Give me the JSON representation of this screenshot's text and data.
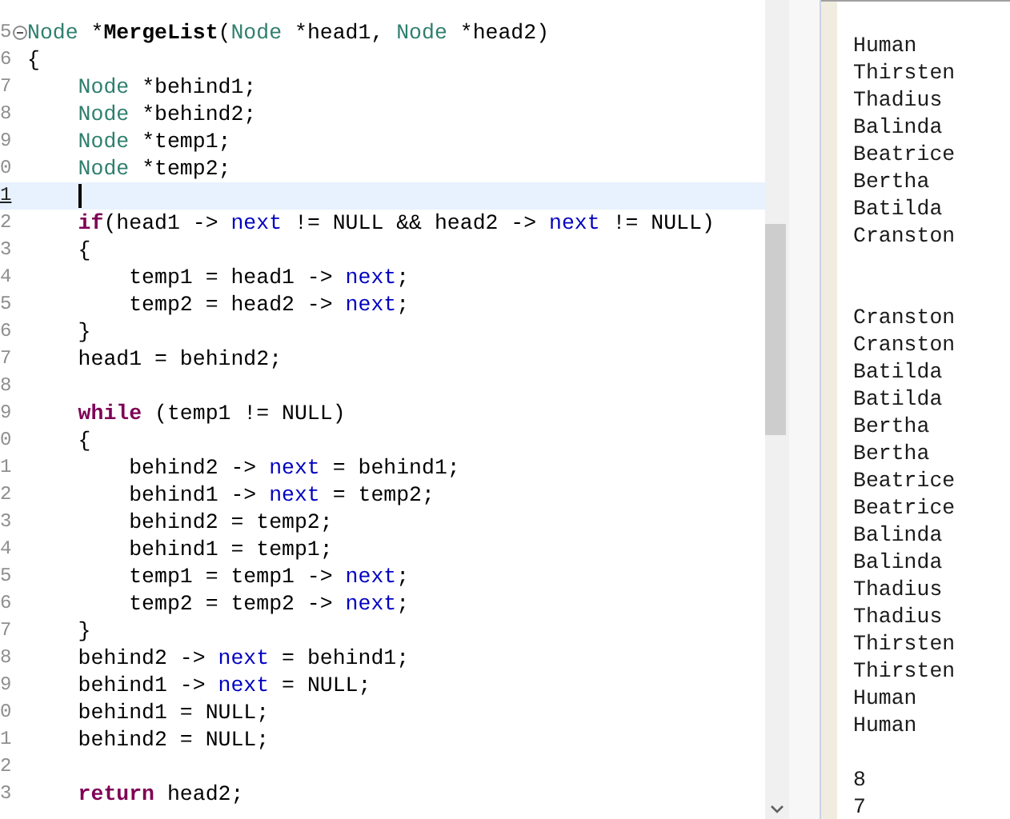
{
  "editor": {
    "lines": [
      {
        "number": "5",
        "fold": true,
        "current": false,
        "tokens": [
          {
            "kind": "type",
            "text": "Node"
          },
          {
            "kind": "plain",
            "text": " *"
          },
          {
            "kind": "func",
            "text": "MergeList"
          },
          {
            "kind": "plain",
            "text": "("
          },
          {
            "kind": "type",
            "text": "Node"
          },
          {
            "kind": "plain",
            "text": " *head1, "
          },
          {
            "kind": "type",
            "text": "Node"
          },
          {
            "kind": "plain",
            "text": " *head2)"
          }
        ]
      },
      {
        "number": "6",
        "fold": false,
        "current": false,
        "tokens": [
          {
            "kind": "plain",
            "text": "{"
          }
        ]
      },
      {
        "number": "7",
        "fold": false,
        "current": false,
        "tokens": [
          {
            "kind": "type",
            "text": "    Node"
          },
          {
            "kind": "plain",
            "text": " *behind1;"
          }
        ]
      },
      {
        "number": "8",
        "fold": false,
        "current": false,
        "tokens": [
          {
            "kind": "type",
            "text": "    Node"
          },
          {
            "kind": "plain",
            "text": " *behind2;"
          }
        ]
      },
      {
        "number": "9",
        "fold": false,
        "current": false,
        "tokens": [
          {
            "kind": "type",
            "text": "    Node"
          },
          {
            "kind": "plain",
            "text": " *temp1;"
          }
        ]
      },
      {
        "number": "0",
        "fold": false,
        "current": false,
        "tokens": [
          {
            "kind": "type",
            "text": "    Node"
          },
          {
            "kind": "plain",
            "text": " *temp2;"
          }
        ]
      },
      {
        "number": "1",
        "fold": false,
        "current": true
      },
      {
        "number": "2",
        "fold": false,
        "current": false,
        "tokens": [
          {
            "kind": "keyword",
            "text": "    if"
          },
          {
            "kind": "plain",
            "text": "(head1 -> "
          },
          {
            "kind": "field",
            "text": "next"
          },
          {
            "kind": "plain",
            "text": " != NULL && head2 -> "
          },
          {
            "kind": "field",
            "text": "next"
          },
          {
            "kind": "plain",
            "text": " != NULL)"
          }
        ]
      },
      {
        "number": "3",
        "fold": false,
        "current": false,
        "tokens": [
          {
            "kind": "plain",
            "text": "    {"
          }
        ]
      },
      {
        "number": "4",
        "fold": false,
        "current": false,
        "tokens": [
          {
            "kind": "plain",
            "text": "        temp1 = head1 -> "
          },
          {
            "kind": "field",
            "text": "next"
          },
          {
            "kind": "plain",
            "text": ";"
          }
        ]
      },
      {
        "number": "5",
        "fold": false,
        "current": false,
        "tokens": [
          {
            "kind": "plain",
            "text": "        temp2 = head2 -> "
          },
          {
            "kind": "field",
            "text": "next"
          },
          {
            "kind": "plain",
            "text": ";"
          }
        ]
      },
      {
        "number": "6",
        "fold": false,
        "current": false,
        "tokens": [
          {
            "kind": "plain",
            "text": "    }"
          }
        ]
      },
      {
        "number": "7",
        "fold": false,
        "current": false,
        "tokens": [
          {
            "kind": "plain",
            "text": "    head1 = behind2;"
          }
        ]
      },
      {
        "number": "8",
        "fold": false,
        "current": false
      },
      {
        "number": "9",
        "fold": false,
        "current": false,
        "tokens": [
          {
            "kind": "keyword",
            "text": "    while"
          },
          {
            "kind": "plain",
            "text": " (temp1 != NULL)"
          }
        ]
      },
      {
        "number": "0",
        "fold": false,
        "current": false,
        "tokens": [
          {
            "kind": "plain",
            "text": "    {"
          }
        ]
      },
      {
        "number": "1",
        "fold": false,
        "current": false,
        "tokens": [
          {
            "kind": "plain",
            "text": "        behind2 -> "
          },
          {
            "kind": "field",
            "text": "next"
          },
          {
            "kind": "plain",
            "text": " = behind1;"
          }
        ]
      },
      {
        "number": "2",
        "fold": false,
        "current": false,
        "tokens": [
          {
            "kind": "plain",
            "text": "        behind1 -> "
          },
          {
            "kind": "field",
            "text": "next"
          },
          {
            "kind": "plain",
            "text": " = temp2;"
          }
        ]
      },
      {
        "number": "3",
        "fold": false,
        "current": false,
        "tokens": [
          {
            "kind": "plain",
            "text": "        behind2 = temp2;"
          }
        ]
      },
      {
        "number": "4",
        "fold": false,
        "current": false,
        "tokens": [
          {
            "kind": "plain",
            "text": "        behind1 = temp1;"
          }
        ]
      },
      {
        "number": "5",
        "fold": false,
        "current": false,
        "tokens": [
          {
            "kind": "plain",
            "text": "        temp1 = temp1 -> "
          },
          {
            "kind": "field",
            "text": "next"
          },
          {
            "kind": "plain",
            "text": ";"
          }
        ]
      },
      {
        "number": "6",
        "fold": false,
        "current": false,
        "tokens": [
          {
            "kind": "plain",
            "text": "        temp2 = temp2 -> "
          },
          {
            "kind": "field",
            "text": "next"
          },
          {
            "kind": "plain",
            "text": ";"
          }
        ]
      },
      {
        "number": "7",
        "fold": false,
        "current": false,
        "tokens": [
          {
            "kind": "plain",
            "text": "    }"
          }
        ]
      },
      {
        "number": "8",
        "fold": false,
        "current": false,
        "tokens": [
          {
            "kind": "plain",
            "text": "    behind2 -> "
          },
          {
            "kind": "field",
            "text": "next"
          },
          {
            "kind": "plain",
            "text": " = behind1;"
          }
        ]
      },
      {
        "number": "9",
        "fold": false,
        "current": false,
        "tokens": [
          {
            "kind": "plain",
            "text": "    behind1 -> "
          },
          {
            "kind": "field",
            "text": "next"
          },
          {
            "kind": "plain",
            "text": " = NULL;"
          }
        ]
      },
      {
        "number": "0",
        "fold": false,
        "current": false,
        "tokens": [
          {
            "kind": "plain",
            "text": "    behind1 = NULL;"
          }
        ]
      },
      {
        "number": "1",
        "fold": false,
        "current": false,
        "tokens": [
          {
            "kind": "plain",
            "text": "    behind2 = NULL;"
          }
        ]
      },
      {
        "number": "2",
        "fold": false,
        "current": false
      },
      {
        "number": "3",
        "fold": false,
        "current": false,
        "tokens": [
          {
            "kind": "keyword",
            "text": "    return"
          },
          {
            "kind": "plain",
            "text": " head2;"
          }
        ]
      }
    ]
  },
  "console": {
    "lines": [
      {
        "kind": "text",
        "text": "Human"
      },
      {
        "kind": "text",
        "text": "Thirsten"
      },
      {
        "kind": "text",
        "text": "Thadius"
      },
      {
        "kind": "text",
        "text": "Balinda"
      },
      {
        "kind": "text",
        "text": "Beatrice"
      },
      {
        "kind": "text",
        "text": "Bertha"
      },
      {
        "kind": "text",
        "text": "Batilda"
      },
      {
        "kind": "text",
        "text": "Cranston"
      },
      {
        "kind": "blank"
      },
      {
        "kind": "blank"
      },
      {
        "kind": "text",
        "text": "Cranston"
      },
      {
        "kind": "text",
        "text": "Cranston"
      },
      {
        "kind": "text",
        "text": "Batilda"
      },
      {
        "kind": "text",
        "text": "Batilda"
      },
      {
        "kind": "text",
        "text": "Bertha"
      },
      {
        "kind": "text",
        "text": "Bertha"
      },
      {
        "kind": "text",
        "text": "Beatrice"
      },
      {
        "kind": "text",
        "text": "Beatrice"
      },
      {
        "kind": "text",
        "text": "Balinda"
      },
      {
        "kind": "text",
        "text": "Balinda"
      },
      {
        "kind": "text",
        "text": "Thadius"
      },
      {
        "kind": "text",
        "text": "Thadius"
      },
      {
        "kind": "text",
        "text": "Thirsten"
      },
      {
        "kind": "text",
        "text": "Thirsten"
      },
      {
        "kind": "text",
        "text": "Human"
      },
      {
        "kind": "text",
        "text": "Human"
      },
      {
        "kind": "blank"
      },
      {
        "kind": "text",
        "text": "8"
      },
      {
        "kind": "text",
        "text": "7"
      }
    ]
  }
}
